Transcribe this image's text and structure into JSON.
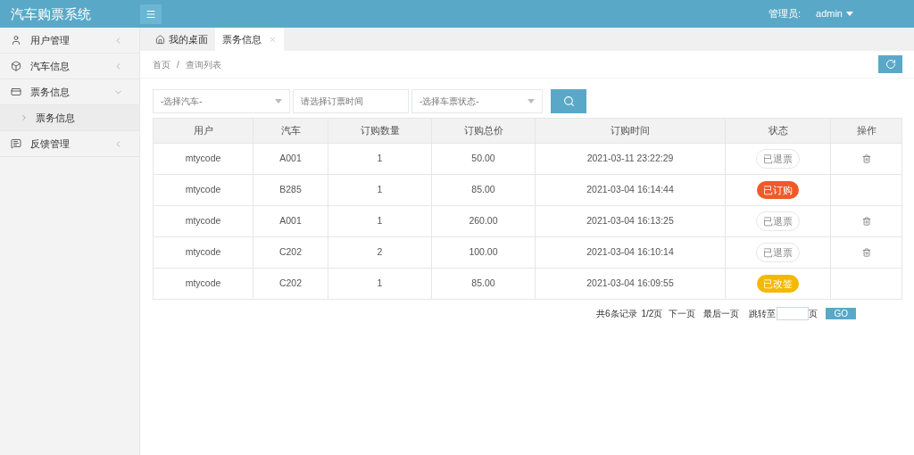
{
  "header": {
    "title": "汽车购票系统",
    "admin_label": "管理员:",
    "admin_name": "admin"
  },
  "sidebar": {
    "items": [
      {
        "label": "用户管理",
        "expanded": false
      },
      {
        "label": "汽车信息",
        "expanded": false
      },
      {
        "label": "票务信息",
        "expanded": true,
        "children": [
          {
            "label": "票务信息"
          }
        ]
      },
      {
        "label": "反馈管理",
        "expanded": false
      }
    ]
  },
  "tabs": [
    {
      "label": "我的桌面",
      "selected": false
    },
    {
      "label": "票务信息",
      "selected": true
    }
  ],
  "breadcrumb": [
    "首页",
    "/",
    "查询列表"
  ],
  "filters": {
    "car": {
      "placeholder": "-选择汽车-"
    },
    "time": {
      "placeholder": "请选择订票时间"
    },
    "status": {
      "placeholder": "-选择车票状态-"
    }
  },
  "table": {
    "columns": [
      "用户",
      "汽车",
      "订购数量",
      "订购总价",
      "订购时间",
      "状态",
      "操作"
    ],
    "rows": [
      {
        "user": "mtycode",
        "car": "A001",
        "qty": "1",
        "total": "50.00",
        "time": "2021-03-11 23:22:29",
        "status": {
          "kind": "refunded",
          "label": "已退票"
        },
        "deletable": true
      },
      {
        "user": "mtycode",
        "car": "B285",
        "qty": "1",
        "total": "85.00",
        "time": "2021-03-04 16:14:44",
        "status": {
          "kind": "ordered",
          "label": "已订购"
        },
        "deletable": false
      },
      {
        "user": "mtycode",
        "car": "A001",
        "qty": "1",
        "total": "260.00",
        "time": "2021-03-04 16:13:25",
        "status": {
          "kind": "refunded",
          "label": "已退票"
        },
        "deletable": true
      },
      {
        "user": "mtycode",
        "car": "C202",
        "qty": "2",
        "total": "100.00",
        "time": "2021-03-04 16:10:14",
        "status": {
          "kind": "refunded",
          "label": "已退票"
        },
        "deletable": true
      },
      {
        "user": "mtycode",
        "car": "C202",
        "qty": "1",
        "total": "85.00",
        "time": "2021-03-04 16:09:55",
        "status": {
          "kind": "changed",
          "label": "已改签"
        },
        "deletable": false
      }
    ]
  },
  "pagination": {
    "records": "共6条记录",
    "page": "1/2页",
    "next": "下一页",
    "last": "最后一页",
    "jump": "跳转至",
    "unit": "页",
    "go": "GO"
  }
}
